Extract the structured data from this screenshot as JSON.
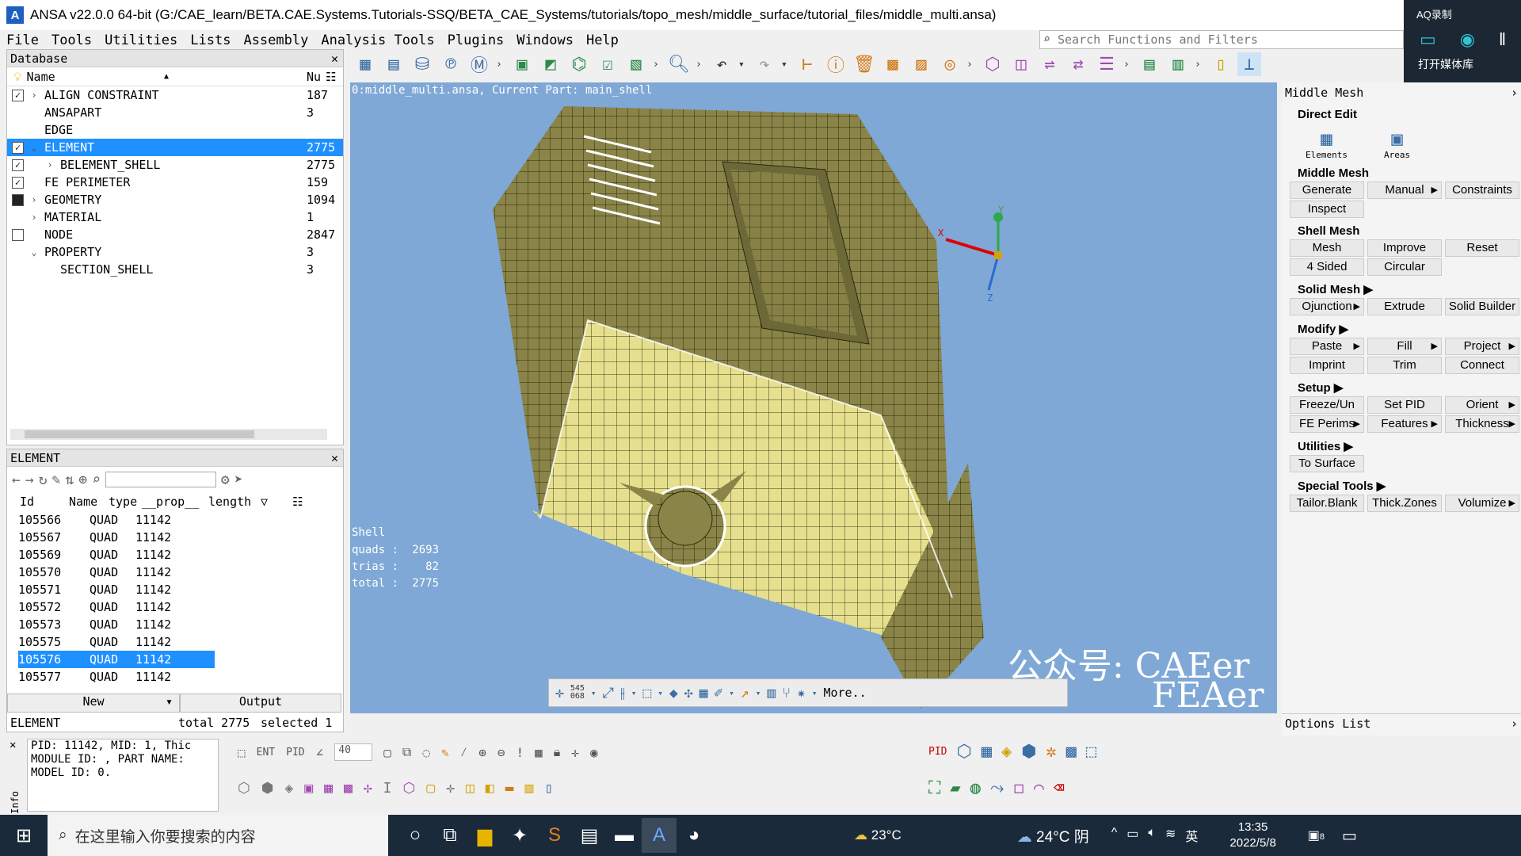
{
  "window": {
    "title": "ANSA v22.0.0 64-bit (G:/CAE_learn/BETA.CAE.Systems.Tutorials-SSQ/BETA_CAE_Systems/tutorials/topo_mesh/middle_surface/tutorial_files/middle_multi.ansa)",
    "app_icon_letter": "A"
  },
  "menu": [
    "File",
    "Tools",
    "Utilities",
    "Lists",
    "Assembly",
    "Analysis Tools",
    "Plugins",
    "Windows",
    "Help"
  ],
  "search": {
    "placeholder": "Search Functions and Filters"
  },
  "overlay": {
    "recording": "AQ录制",
    "media_lib": "打开媒体库"
  },
  "database": {
    "title": "Database",
    "col_name": "Name",
    "col_num": "Nu",
    "rows": [
      {
        "name": "ALIGN CONSTRAINT",
        "num": "187"
      },
      {
        "name": "ANSAPART",
        "num": "3"
      },
      {
        "name": "EDGE",
        "num": ""
      },
      {
        "name": "ELEMENT",
        "num": "2775"
      },
      {
        "name": "BELEMENT_SHELL",
        "num": "2775"
      },
      {
        "name": "FE PERIMETER",
        "num": "159"
      },
      {
        "name": "GEOMETRY",
        "num": "1094"
      },
      {
        "name": "MATERIAL",
        "num": "1"
      },
      {
        "name": "NODE",
        "num": "2847"
      },
      {
        "name": "PROPERTY",
        "num": "3"
      },
      {
        "name": "SECTION_SHELL",
        "num": "3"
      }
    ]
  },
  "element_panel": {
    "title": "ELEMENT",
    "cols": [
      "Id",
      "Name",
      "type",
      "__prop__",
      "length"
    ],
    "rows": [
      {
        "id": "105566",
        "type": "QUAD",
        "prop": "11142"
      },
      {
        "id": "105567",
        "type": "QUAD",
        "prop": "11142"
      },
      {
        "id": "105569",
        "type": "QUAD",
        "prop": "11142"
      },
      {
        "id": "105570",
        "type": "QUAD",
        "prop": "11142"
      },
      {
        "id": "105571",
        "type": "QUAD",
        "prop": "11142"
      },
      {
        "id": "105572",
        "type": "QUAD",
        "prop": "11142"
      },
      {
        "id": "105573",
        "type": "QUAD",
        "prop": "11142"
      },
      {
        "id": "105575",
        "type": "QUAD",
        "prop": "11142"
      },
      {
        "id": "105576",
        "type": "QUAD",
        "prop": "11142"
      },
      {
        "id": "105577",
        "type": "QUAD",
        "prop": "11142"
      }
    ],
    "new_label": "New",
    "output_label": "Output",
    "status_name": "ELEMENT",
    "status_total": "total 2775",
    "status_selected": "selected 1"
  },
  "viewport": {
    "header": "0:middle_multi.ansa,  Current Part: main_shell",
    "stats_title": "Shell",
    "stats": [
      {
        "label": "quads :",
        "value": "2693"
      },
      {
        "label": "trias :",
        "value": "82"
      },
      {
        "label": "total :",
        "value": "2775"
      }
    ],
    "watermark1": "公众号: CAEer",
    "watermark2": "FEAer",
    "toolbar_nums1": "545",
    "toolbar_nums2": "068",
    "more_label": "More..",
    "mesh_color": "#e6e08e",
    "bg_color": "#7fa8d6",
    "axis_x": "X",
    "axis_y": "Y",
    "axis_z": "Z"
  },
  "middle_mesh": {
    "panel_title": "Middle Mesh",
    "direct_edit": "Direct Edit",
    "elements_label": "Elements",
    "areas_label": "Areas",
    "sections": [
      {
        "title": "Middle Mesh",
        "rows": [
          [
            {
              "l": "Generate"
            },
            {
              "l": "Manual",
              "a": true
            },
            {
              "l": "Constraints"
            }
          ],
          [
            {
              "l": "Inspect"
            }
          ]
        ]
      },
      {
        "title": "Shell Mesh",
        "rows": [
          [
            {
              "l": "Mesh"
            },
            {
              "l": "Improve"
            },
            {
              "l": "Reset"
            }
          ],
          [
            {
              "l": "4 Sided"
            },
            {
              "l": "Circular"
            }
          ]
        ]
      },
      {
        "title": "Solid Mesh ▶",
        "rows": [
          [
            {
              "l": "Ojunction",
              "a": true
            },
            {
              "l": "Extrude"
            },
            {
              "l": "Solid Builder"
            }
          ]
        ]
      },
      {
        "title": "Modify ▶",
        "rows": [
          [
            {
              "l": "Paste",
              "a": true
            },
            {
              "l": "Fill",
              "a": true
            },
            {
              "l": "Project",
              "a": true
            }
          ],
          [
            {
              "l": "Imprint"
            },
            {
              "l": "Trim"
            },
            {
              "l": "Connect"
            }
          ]
        ]
      },
      {
        "title": "Setup ▶",
        "rows": [
          [
            {
              "l": "Freeze/Un"
            },
            {
              "l": "Set PID"
            },
            {
              "l": "Orient",
              "a": true
            }
          ],
          [
            {
              "l": "FE Perims",
              "a": true
            },
            {
              "l": "Features",
              "a": true
            },
            {
              "l": "Thickness",
              "a": true
            }
          ]
        ]
      },
      {
        "title": "Utilities ▶",
        "rows": [
          [
            {
              "l": "To Surface"
            }
          ]
        ]
      },
      {
        "title": "Special Tools ▶",
        "rows": [
          [
            {
              "l": "Tailor.Blank"
            },
            {
              "l": "Thick.Zones"
            },
            {
              "l": "Volumize",
              "a": true
            }
          ]
        ]
      }
    ],
    "options_title": "Options List"
  },
  "info": {
    "lines": [
      "PID: 11142, MID: 1, Thic",
      "MODULE ID: , PART NAME:",
      "MODEL ID: 0."
    ],
    "tab_label": "Info",
    "ent_label": "ENT",
    "pid_label": "PID",
    "angle_value": "40",
    "pid_label2": "PID"
  },
  "taskbar": {
    "search_placeholder": "在这里输入你要搜索的内容",
    "weather1": "23°C",
    "weather2": "24°C 阴",
    "ime": "英",
    "time": "13:35",
    "date": "2022/5/8",
    "notif": "8"
  }
}
